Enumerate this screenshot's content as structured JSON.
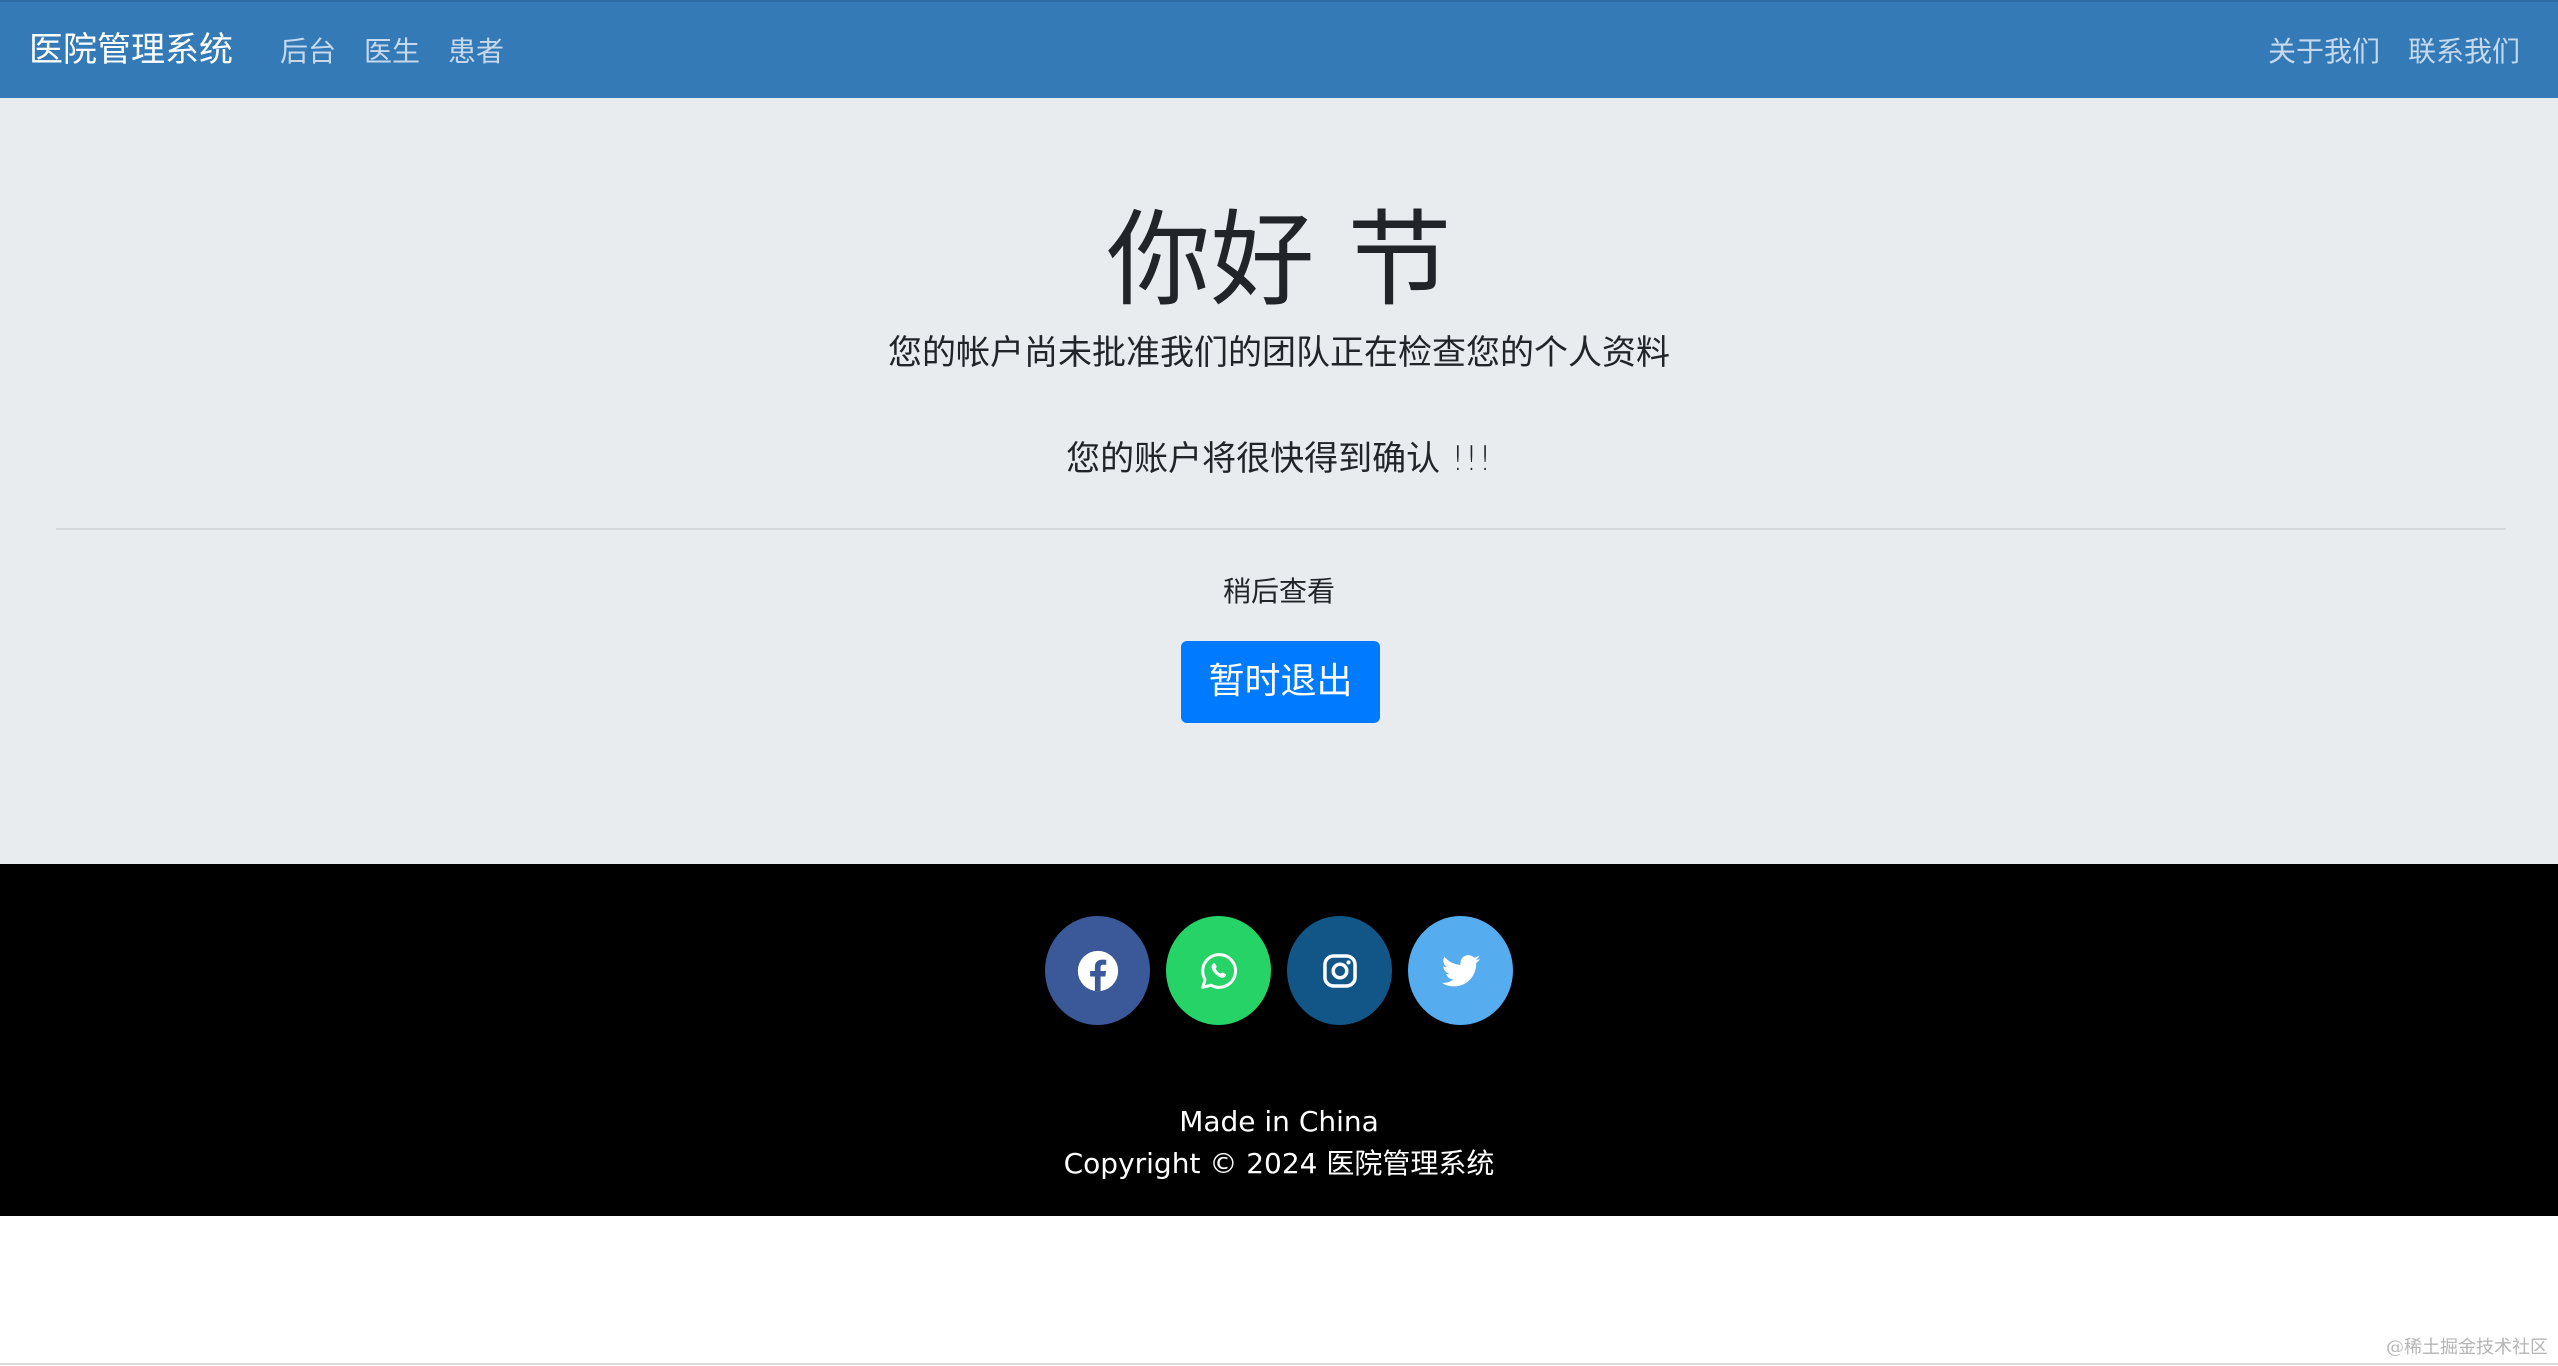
{
  "navbar": {
    "brand": "医院管理系统",
    "left_links": [
      "后台",
      "医生",
      "患者"
    ],
    "right_links": [
      "关于我们",
      "联系我们"
    ],
    "background": "#337ab7"
  },
  "main": {
    "greeting": "你好 节",
    "pending_message": "您的帐户尚未批准我们的团队正在检查您的个人资料",
    "confirm_message": "您的账户将很快得到确认 !!!",
    "check_later": "稍后查看",
    "logout_button": "暂时退出",
    "button_color": "#007bff"
  },
  "footer": {
    "social": [
      {
        "name": "facebook-icon",
        "color": "#3b5998"
      },
      {
        "name": "whatsapp-icon",
        "color": "#25d366"
      },
      {
        "name": "instagram-icon",
        "color": "#125688"
      },
      {
        "name": "twitter-icon",
        "color": "#55acee"
      }
    ],
    "made_in": "Made in China",
    "copyright": "Copyright © 2024 医院管理系统"
  },
  "watermark": "@稀土掘金技术社区"
}
